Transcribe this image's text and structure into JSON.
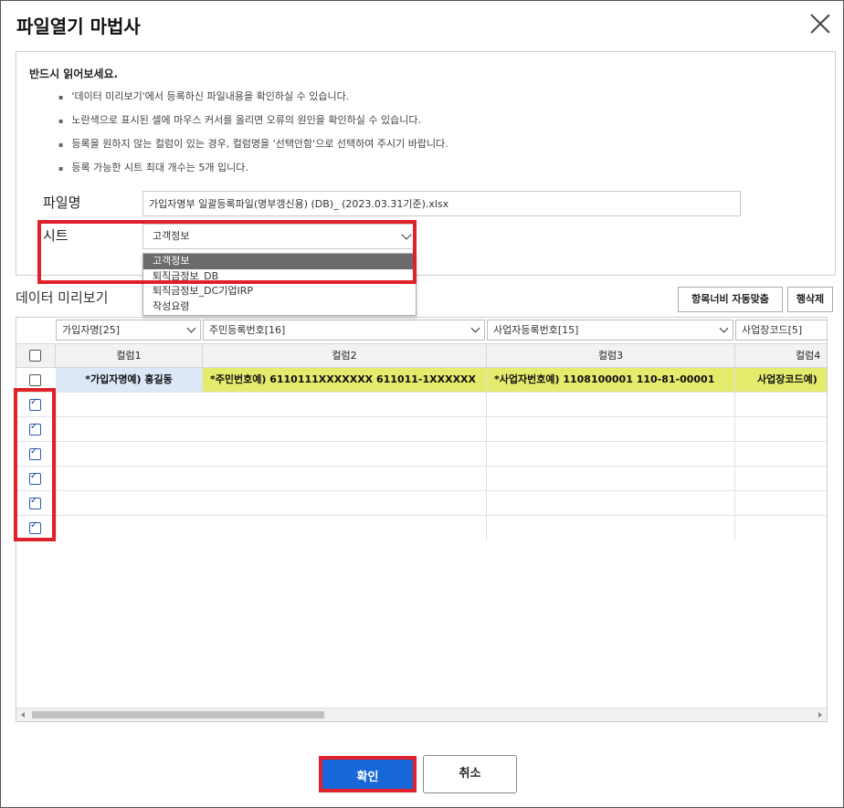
{
  "dialog": {
    "title": "파일열기 마법사"
  },
  "info": {
    "title": "반드시 읽어보세요.",
    "items": [
      "'데이터 미리보기'에서 등록하신 파일내용을 확인하실 수 있습니다.",
      "노란색으로 표시된 셀에 마우스 커서를 올리면 오류의 원인을 확인하실 수 있습니다.",
      "등록을 원하지 않는 컬럼이 있는 경우, 컬럼명을 '선택안함'으로 선택하여 주시기 바랍니다.",
      "등록 가능한 시트 최대 개수는 5개 입니다."
    ]
  },
  "file": {
    "label": "파일명",
    "value": "가입자명부 일괄등록파일(명부갱신용) (DB)_              (2023.03.31기준).xlsx"
  },
  "sheet": {
    "label": "시트",
    "selected": "고객정보",
    "options": [
      "고객정보",
      "퇴직금정보_DB",
      "퇴직금정보_DC기업IRP",
      "작성요령"
    ]
  },
  "preview": {
    "title": "데이터 미리보기",
    "autofit_label": "항목너비 자동맞춤",
    "delete_row_label": "행삭제",
    "mappings": [
      "가입자명[25]",
      "주민등록번호[16]",
      "사업자등록번호[15]",
      "사업장코드[5]"
    ],
    "columns": [
      "컬럼1",
      "컬럼2",
      "컬럼3",
      "컬럼4"
    ],
    "rows": [
      {
        "checked": false,
        "cells": [
          "*가입자명예) 홍길동",
          "*주민번호예) 6110111XXXXXXX     611011-1XXXXXX",
          "*사업자번호예) 1108100001     110-81-00001",
          "사업장코드예)"
        ]
      },
      {
        "checked": true
      },
      {
        "checked": true
      },
      {
        "checked": true
      },
      {
        "checked": true
      },
      {
        "checked": true
      },
      {
        "checked": true
      }
    ]
  },
  "footer": {
    "ok_label": "확인",
    "cancel_label": "취소"
  },
  "colors": {
    "primary": "#1767d8",
    "highlight": "#e0202a",
    "name_cell": "#dce8f8",
    "error_cell": "#e4ec6e"
  }
}
